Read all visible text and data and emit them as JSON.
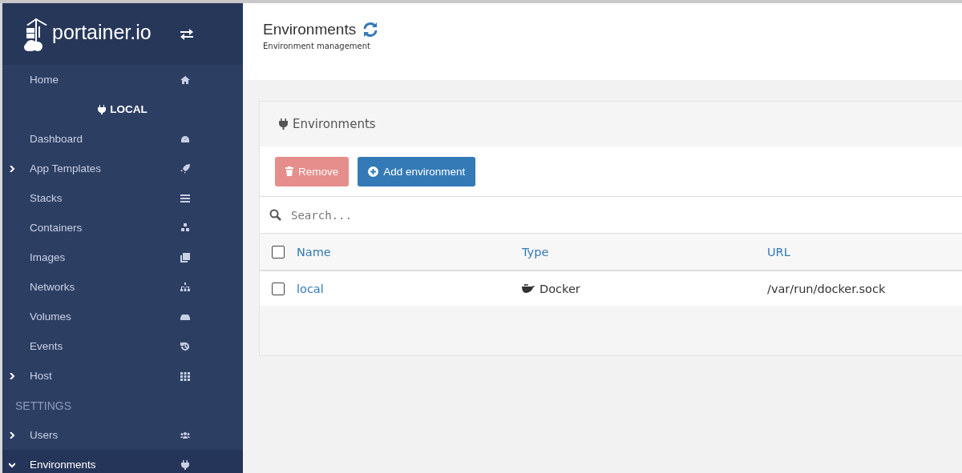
{
  "sidebar": {
    "logo": "portainer.io",
    "items": [
      {
        "kind": "item",
        "label": "Home",
        "selected": false
      },
      {
        "kind": "endpoint",
        "label": "LOCAL"
      },
      {
        "kind": "item",
        "label": "Dashboard",
        "selected": false
      },
      {
        "kind": "item",
        "label": "App Templates",
        "selected": false,
        "expanded": false
      },
      {
        "kind": "item",
        "label": "Stacks",
        "selected": false
      },
      {
        "kind": "item",
        "label": "Containers",
        "selected": false
      },
      {
        "kind": "item",
        "label": "Images",
        "selected": false
      },
      {
        "kind": "item",
        "label": "Networks",
        "selected": false
      },
      {
        "kind": "item",
        "label": "Volumes",
        "selected": false
      },
      {
        "kind": "item",
        "label": "Events",
        "selected": false
      },
      {
        "kind": "item",
        "label": "Host",
        "selected": false,
        "expanded": false
      },
      {
        "kind": "heading",
        "label": "SETTINGS"
      },
      {
        "kind": "item",
        "label": "Users",
        "selected": false,
        "expanded": false
      },
      {
        "kind": "item",
        "label": "Environments",
        "selected": true,
        "expanded": true
      }
    ]
  },
  "header": {
    "title": "Environments",
    "subtitle": "Environment management"
  },
  "panel": {
    "title": "Environments",
    "buttons": [
      {
        "kind": "remove",
        "label": "Remove",
        "disabled": true
      },
      {
        "kind": "add",
        "label": "Add environment",
        "disabled": false
      }
    ],
    "search": {
      "placeholder": "Search..."
    },
    "columns": [
      "Name",
      "Type",
      "URL"
    ],
    "select_all": {
      "checked": false
    },
    "rows": [
      {
        "name": "local",
        "type": "Docker",
        "url": "/var/run/docker.sock",
        "checked": false
      }
    ]
  }
}
